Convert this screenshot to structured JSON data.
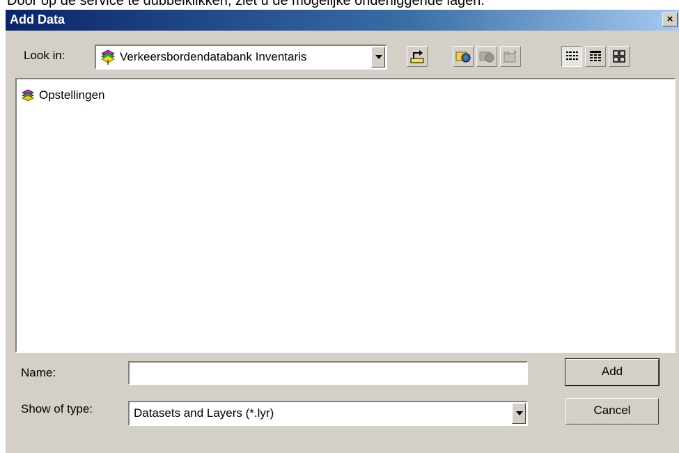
{
  "caption": "Door op de service te dubbelklikken, ziet u de mogelijke onderliggende lagen.",
  "dialog": {
    "title": "Add Data",
    "close_label": "×",
    "look_in_label": "Look in:",
    "look_in_value": "Verkeersbordendatabank Inventaris",
    "toolbar_icons": [
      "up-one-level-icon",
      "connect-to-folder-icon",
      "disconnect-icon",
      "new-folder-icon",
      "list-view-icon",
      "details-view-icon",
      "thumbnails-view-icon"
    ],
    "items": [
      {
        "label": "Opstellingen",
        "icon": "layer-group-icon"
      }
    ],
    "name_label": "Name:",
    "name_value": "",
    "type_label": "Show of type:",
    "type_value": "Datasets and Layers (*.lyr)",
    "add_label": "Add",
    "cancel_label": "Cancel"
  },
  "colors": {
    "title_bar": "#0a246a",
    "dialog_face": "#d4d0c8"
  }
}
